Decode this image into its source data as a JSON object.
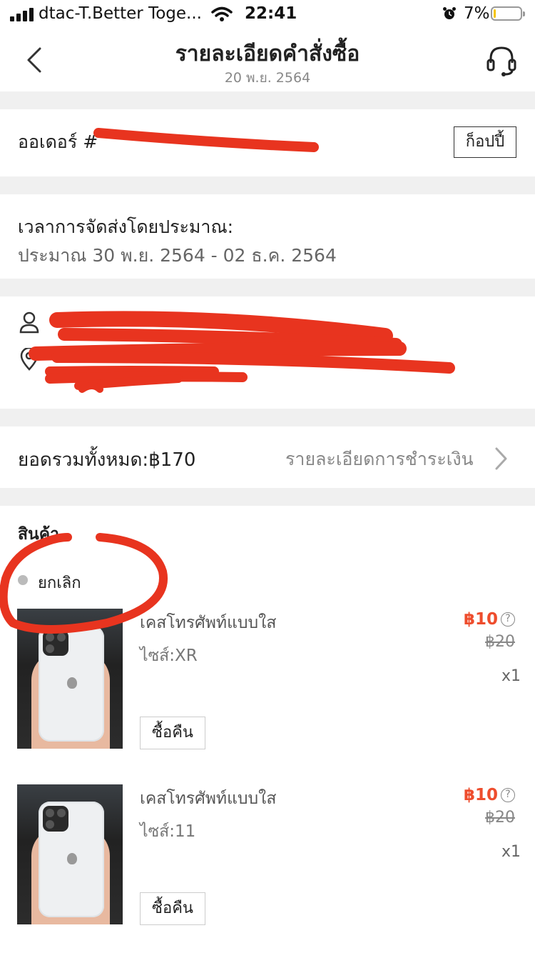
{
  "status_bar": {
    "carrier": "dtac-T.Better Toge...",
    "time": "22:41",
    "battery_percent": "7%",
    "battery_level": 0.07,
    "battery_color": "#f5c400",
    "icons": [
      "signal-icon",
      "wifi-icon",
      "alarm-icon",
      "battery-icon"
    ]
  },
  "header": {
    "title": "รายละเอียดคำสั่งซื้อ",
    "date": "20 พ.ย. 2564",
    "back_icon": "chevron-left-icon",
    "support_icon": "headset-icon"
  },
  "order": {
    "label": "ออเดอร์ #",
    "copy_label": "ก็อปปี้"
  },
  "shipping": {
    "label": "เวลาการจัดส่งโดยประมาณ:",
    "range": "ประมาณ 30 พ.ย. 2564 - 02 ธ.ค. 2564"
  },
  "address": {
    "name_line": "",
    "address_line": "",
    "icons": [
      "user-icon",
      "location-pin-icon"
    ]
  },
  "payment": {
    "total_label": "ยอดรวมทั้งหมด:฿170",
    "details_link": "รายละเอียดการชำระเงิน"
  },
  "products": {
    "heading": "สินค้า",
    "status": "ยกเลิก",
    "items": [
      {
        "name": "เคสโทรศัพท์แบบใส",
        "variant": "ไซส์:XR",
        "price": "฿10",
        "original_price": "฿20",
        "qty": "x1",
        "action": "ซื้อคืน"
      },
      {
        "name": "เคสโทรศัพท์แบบใส",
        "variant": "ไซส์:11",
        "price": "฿10",
        "original_price": "฿20",
        "qty": "x1",
        "action": "ซื้อคืน"
      }
    ]
  },
  "colors": {
    "accent": "#ee4d2d",
    "scribble": "#e8341f",
    "background": "#f0f0f0"
  }
}
